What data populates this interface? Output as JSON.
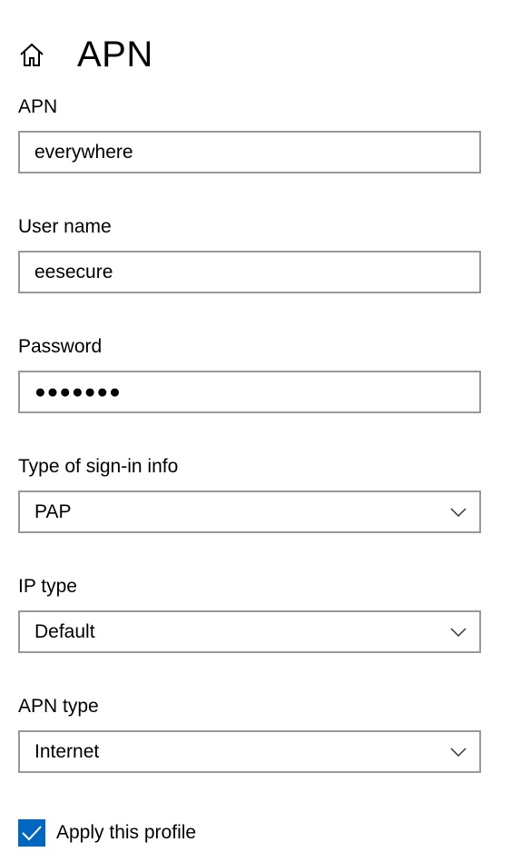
{
  "header": {
    "title": "APN",
    "home_icon": "home-icon"
  },
  "fields": {
    "apn": {
      "label": "APN",
      "value": "everywhere"
    },
    "username": {
      "label": "User name",
      "value": "eesecure"
    },
    "password": {
      "label": "Password",
      "value": "●●●●●●●"
    },
    "signin_type": {
      "label": "Type of sign-in info",
      "value": "PAP"
    },
    "ip_type": {
      "label": "IP type",
      "value": "Default"
    },
    "apn_type": {
      "label": "APN type",
      "value": "Internet"
    }
  },
  "apply_profile": {
    "label": "Apply this profile",
    "checked": true
  },
  "colors": {
    "accent": "#0067c0",
    "border": "#999999"
  }
}
